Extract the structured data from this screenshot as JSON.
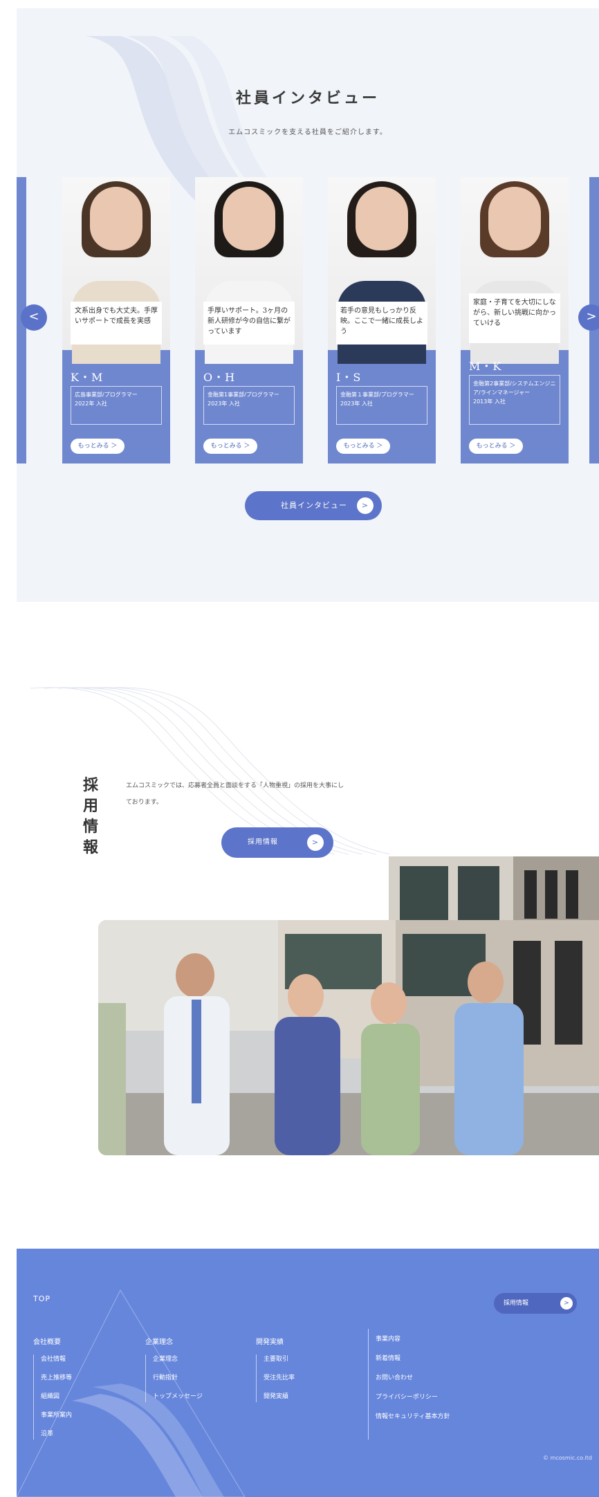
{
  "interview": {
    "title": "社員インタビュー",
    "subtitle": "エムコスミックを支える社員をご紹介します。",
    "cards": [
      {
        "quote": "文系出身でも大丈夫。手厚いサポートで成長を実感",
        "initials": "K・M",
        "dept": "広島事業部/プログラマー",
        "year": "2022年 入社",
        "more": "もっとみる ＞"
      },
      {
        "quote": "手厚いサポート。3ヶ月の新人研修が今の自信に繋がっています",
        "initials": "O・H",
        "dept": "金融第1事業部/プログラマー",
        "year": "2023年 入社",
        "more": "もっとみる ＞"
      },
      {
        "quote": "若手の意見もしっかり反映。ここで一緒に成長しよう",
        "initials": "I・S",
        "dept": "金融第１事業部/プログラマー",
        "year": "2023年 入社",
        "more": "もっとみる ＞"
      },
      {
        "quote": "家庭・子育てを大切にしながら、新しい挑戦に向かっていける",
        "initials": "M・K",
        "dept": "金融第2事業部/システムエンジニア/ラインマネージャー",
        "year": "2013年 入社",
        "more": "もっとみる ＞"
      }
    ],
    "prev_icon": "<",
    "next_icon": ">",
    "cta_label": "社員インタビュー",
    "cta_icon": ">"
  },
  "recruit": {
    "title": "採用情報",
    "text": "エムコスミックでは、応募者全員と面談をする「人物重視」の採用を大事にしております。",
    "button_label": "採用情報",
    "button_icon": ">"
  },
  "footer": {
    "top_label": "TOP",
    "button_label": "採用情報",
    "button_icon": ">",
    "columns": [
      {
        "heading": "会社概要",
        "links": [
          "会社情報",
          "売上推移等",
          "組織図",
          "事業所案内",
          "沿革"
        ]
      },
      {
        "heading": "企業理念",
        "links": [
          "企業理念",
          "行動指針",
          "トップメッセージ"
        ]
      },
      {
        "heading": "開発実績",
        "links": [
          "主要取引",
          "受注先比率",
          "開発実績"
        ]
      }
    ],
    "column4_links": [
      "事業内容",
      "新着情報",
      "お問い合わせ",
      "プライバシーポリシー",
      "情報セキュリティ基本方針"
    ],
    "copyright": "© mcosmic.co.ltd"
  },
  "colors": {
    "accent": "#5c74c9",
    "footer_bg": "#6686dc",
    "card_bg": "#6f87cf",
    "section_bg": "#f1f4f9"
  }
}
